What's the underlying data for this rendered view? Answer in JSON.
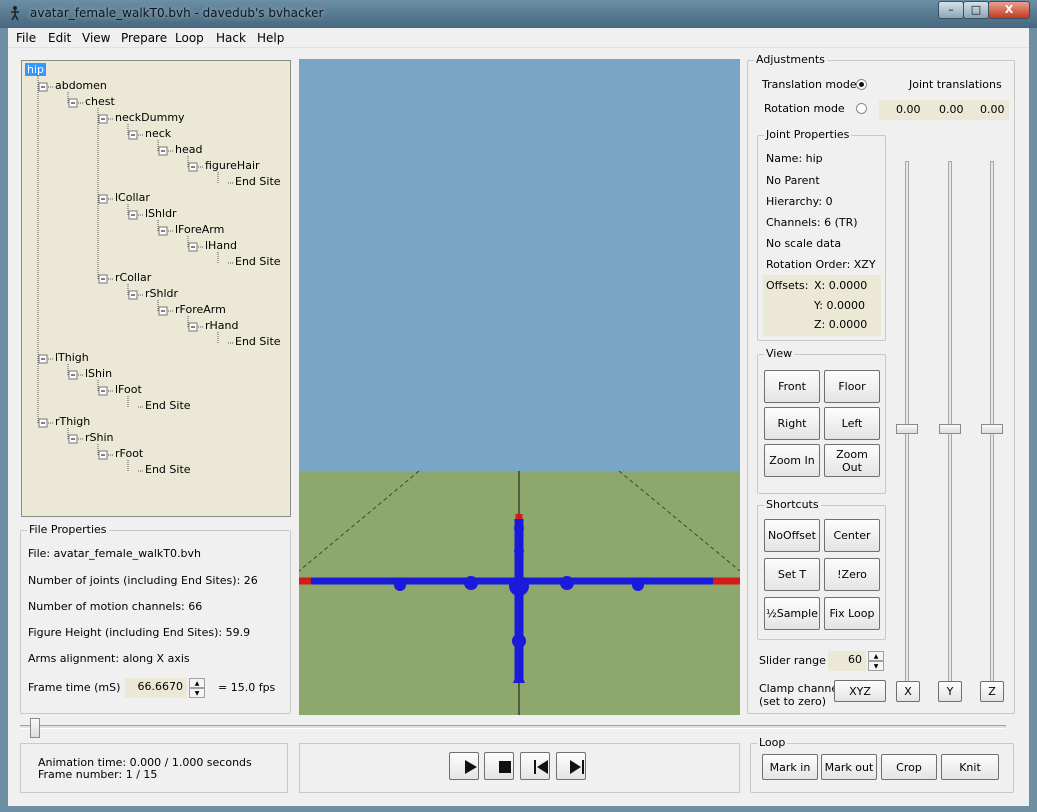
{
  "window": {
    "title": "avatar_female_walkT0.bvh - davedub's bvhacker",
    "minimize": "–",
    "maximize": "□",
    "close": "X"
  },
  "menu": [
    "File",
    "Edit",
    "View",
    "Prepare",
    "Loop",
    "Hack",
    "Help"
  ],
  "tree": [
    {
      "label": "hip",
      "selected": true
    },
    {
      "label": "abdomen"
    },
    {
      "label": "chest"
    },
    {
      "label": "neckDummy"
    },
    {
      "label": "neck"
    },
    {
      "label": "head"
    },
    {
      "label": "figureHair"
    },
    {
      "label": "End Site"
    },
    {
      "label": "lCollar"
    },
    {
      "label": "lShldr"
    },
    {
      "label": "lForeArm"
    },
    {
      "label": "lHand"
    },
    {
      "label": "End Site"
    },
    {
      "label": "rCollar"
    },
    {
      "label": "rShldr"
    },
    {
      "label": "rForeArm"
    },
    {
      "label": "rHand"
    },
    {
      "label": "End Site"
    },
    {
      "label": "lThigh"
    },
    {
      "label": "lShin"
    },
    {
      "label": "lFoot"
    },
    {
      "label": "End Site"
    },
    {
      "label": "rThigh"
    },
    {
      "label": "rShin"
    },
    {
      "label": "rFoot"
    },
    {
      "label": "End Site"
    }
  ],
  "file_properties": {
    "title": "File Properties",
    "file": "File: avatar_female_walkT0.bvh",
    "joints": "Number of joints (including End Sites): 26",
    "channels": "Number of motion channels: 66",
    "height": "Figure Height (including End Sites): 59.9",
    "arms": "Arms alignment: along X axis",
    "frame_time_label": "Frame time (mS)",
    "frame_time_value": "66.6670",
    "fps": "=  15.0 fps"
  },
  "adjustments": {
    "title": "Adjustments",
    "translation_mode": "Translation mode",
    "rotation_mode": "Rotation mode",
    "joint_translations": "Joint translations",
    "translations": [
      "0.00",
      "0.00",
      "0.00"
    ],
    "slider_range_label": "Slider range ±",
    "slider_range_value": "60",
    "clamp_label_1": "Clamp channel",
    "clamp_label_2": "(set to zero)",
    "clamp_buttons": {
      "xyz": "XYZ",
      "x": "X",
      "y": "Y",
      "z": "Z"
    }
  },
  "joint_properties": {
    "title": "Joint Properties",
    "name": "Name: hip",
    "parent": "No Parent",
    "hierarchy": "Hierarchy: 0",
    "channels": "Channels: 6 (TR)",
    "scale": "No scale data",
    "rotation_order": "Rotation Order: XZY",
    "offsets_label": "Offsets:",
    "offset_x": "X:  0.0000",
    "offset_y": "Y:  0.0000",
    "offset_z": "Z:  0.0000"
  },
  "view": {
    "title": "View",
    "front": "Front",
    "floor": "Floor",
    "right": "Right",
    "left": "Left",
    "zoom_in": "Zoom In",
    "zoom_out": "Zoom Out"
  },
  "shortcuts": {
    "title": "Shortcuts",
    "nooffset": "NoOffset",
    "center": "Center",
    "set_t": "Set T",
    "izero": "!Zero",
    "half_sample": "½Sample",
    "fix_loop": "Fix Loop"
  },
  "status": {
    "animation_time": "Animation time: 0.000 / 1.000 seconds",
    "frame_number": "Frame number: 1 / 15"
  },
  "loop": {
    "title": "Loop",
    "mark_in": "Mark in",
    "mark_out": "Mark out",
    "crop": "Crop",
    "knit": "Knit"
  },
  "colors": {
    "sky": "#78a6c4",
    "ground": "#8da86c",
    "skeleton": "#1a1adc",
    "axis_x": "#d41a1a"
  }
}
